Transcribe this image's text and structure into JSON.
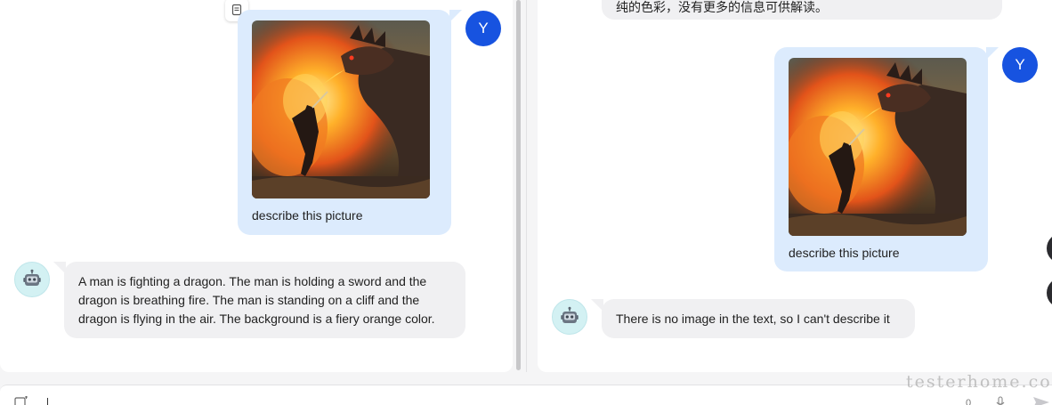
{
  "left_pane": {
    "user_avatar_letter": "Y",
    "user_caption": "describe this picture",
    "bot_reply": "A man is fighting a dragon. The man is holding a sword and the dragon is breathing fire. The man is standing on a cliff and the dragon is flying in the air. The background is a fiery orange color."
  },
  "right_pane": {
    "top_bot_text_partial": "纯的色彩，没有更多的信息可供解读。",
    "user_avatar_letter": "Y",
    "user_caption": "describe this picture",
    "bot_reply": "There is no image in the text, so I can't describe it"
  },
  "input_bar": {
    "counter": "0"
  },
  "watermark": "testerhome.com",
  "icons": [
    "copy-icon",
    "robot-avatar-icon",
    "image-upload-icon",
    "mic-icon",
    "send-icon"
  ],
  "colors": {
    "user_bubble": "#dcebfd",
    "bot_bubble": "#f0f0f2",
    "user_avatar": "#1753e0",
    "bot_avatar": "#d3f1f3"
  }
}
